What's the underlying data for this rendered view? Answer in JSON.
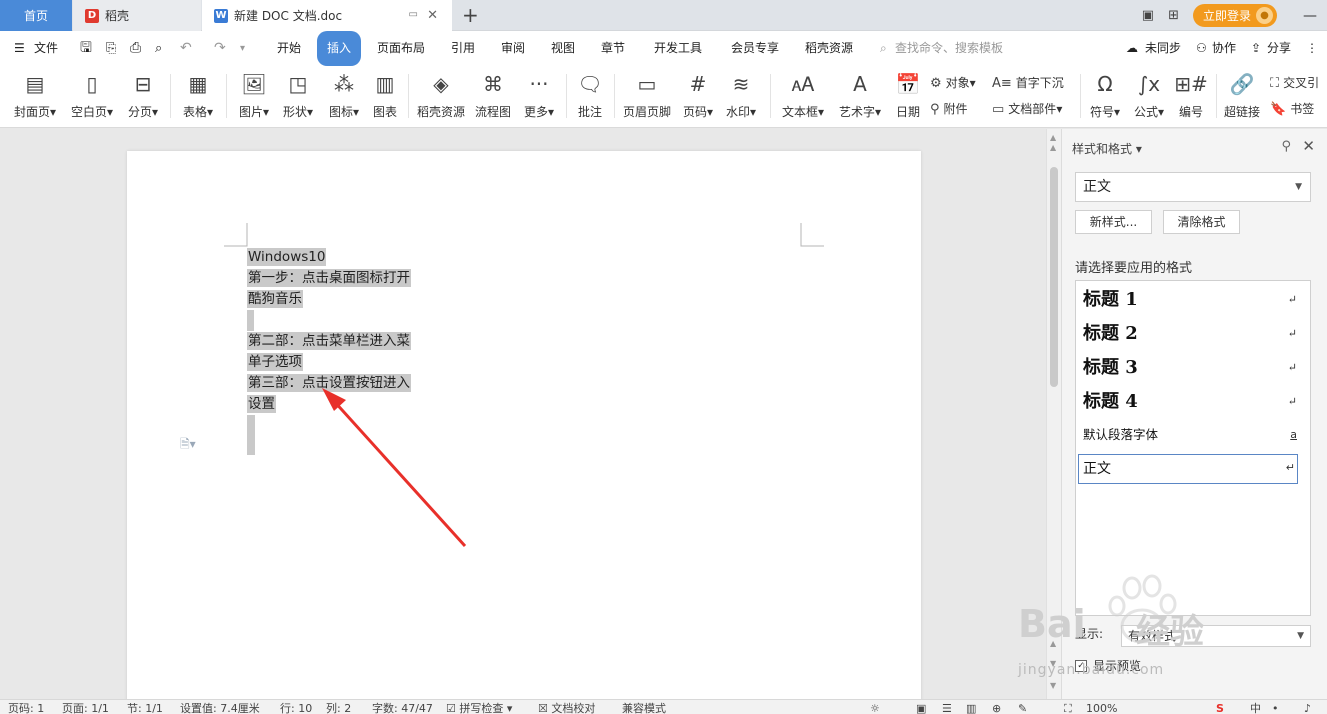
{
  "tabs": {
    "home": "首页",
    "daoke": "稻壳",
    "doc": "新建 DOC 文档.doc",
    "add": "+"
  },
  "titlebar": {
    "login": "立即登录"
  },
  "menu": {
    "file": "文件",
    "items": [
      "开始",
      "插入",
      "页面布局",
      "引用",
      "审阅",
      "视图",
      "章节",
      "开发工具",
      "会员专享",
      "稻壳资源"
    ],
    "search": "查找命令、搜索模板",
    "sync": "未同步",
    "collab": "协作",
    "share": "分享"
  },
  "ribbon": {
    "cover": "封面页",
    "blank": "空白页",
    "pagebreak": "分页",
    "table": "表格",
    "picture": "图片",
    "shape": "形状",
    "icon": "图标",
    "chart": "图表",
    "daoke_res": "稻壳资源",
    "flowchart": "流程图",
    "more": "更多",
    "comment": "批注",
    "header_footer": "页眉页脚",
    "page_num": "页码",
    "watermark": "水印",
    "textbox": "文本框",
    "wordart": "艺术字",
    "date": "日期",
    "object": "对象",
    "attachment": "附件",
    "dropcap": "首字下沉",
    "doc_parts": "文档部件",
    "symbol": "符号",
    "formula": "公式",
    "numbering": "编号",
    "hyperlink": "超链接",
    "crossref": "交叉引",
    "bookmark": "书签"
  },
  "document": {
    "lines": [
      "Windows10",
      "第一步：点击桌面图标打开",
      "酷狗音乐",
      "",
      "第二部：点击菜单栏进入菜",
      "单子选项",
      "第三部：点击设置按钮进入",
      "设置"
    ]
  },
  "panel": {
    "title": "样式和格式",
    "current_style": "正文",
    "new_style": "新样式...",
    "clear_format": "清除格式",
    "apply_label": "请选择要应用的格式",
    "styles": [
      "标题  1",
      "标题  2",
      "标题  3",
      "标题  4",
      "默认段落字体",
      "正文"
    ],
    "show_label": "显示:",
    "show_value": "有效样式",
    "preview": "显示预览"
  },
  "status": {
    "page": "页码: 1",
    "pages": "页面: 1/1",
    "section": "节: 1/1",
    "setting": "设置值: 7.4厘米",
    "row": "行: 10",
    "col": "列: 2",
    "words": "字数: 47/47",
    "spell": "拼写检查",
    "proof": "文档校对",
    "compat": "兼容模式",
    "zoom": "100%"
  },
  "watermark": {
    "brand": "jingyan.baidu.com",
    "cn": "经验",
    "bai": "Bai"
  },
  "colors": {
    "accent": "#4a8ad8",
    "login": "#f29a1e",
    "highlight": "#c9c9c9",
    "arrow": "#e8302a"
  }
}
